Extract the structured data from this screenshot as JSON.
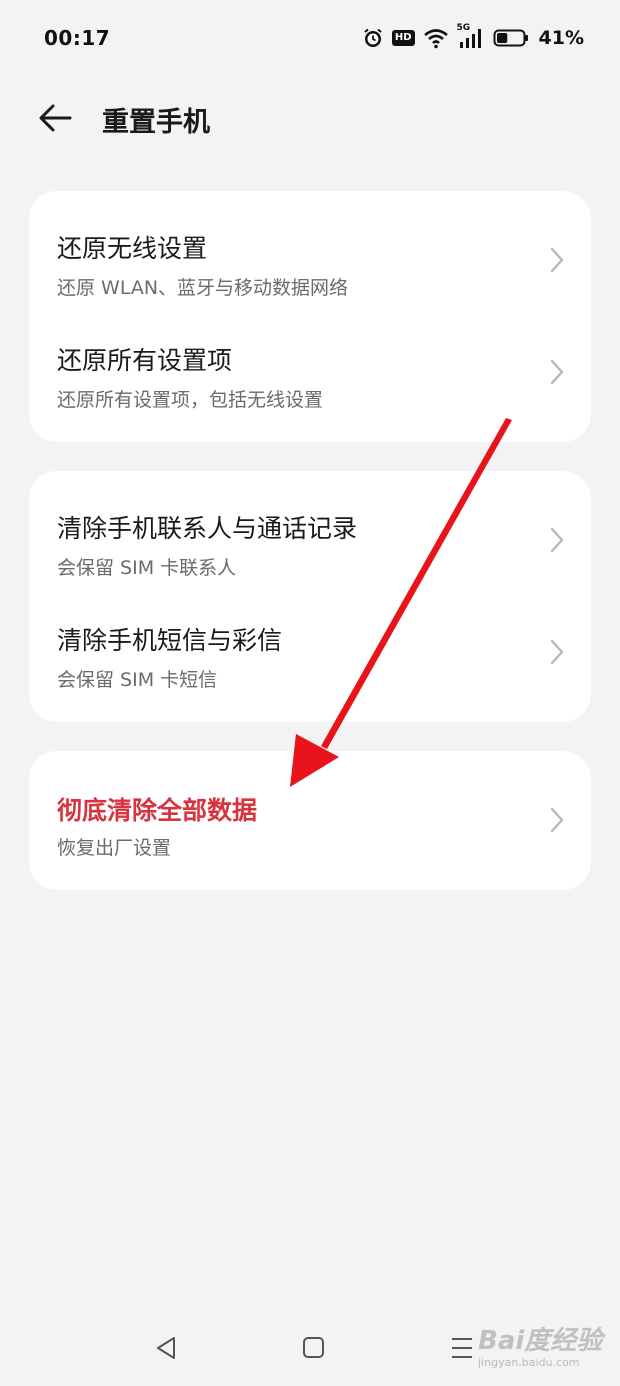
{
  "status": {
    "time": "00:17",
    "hd_label": "HD",
    "network_label": "5G",
    "battery_percent": "41%",
    "battery_level": 0.41
  },
  "header": {
    "title": "重置手机",
    "back_icon": "arrow-left-icon"
  },
  "groups": [
    {
      "items": [
        {
          "title": "还原无线设置",
          "subtitle": "还原 WLAN、蓝牙与移动数据网络"
        },
        {
          "title": "还原所有设置项",
          "subtitle": "还原所有设置项，包括无线设置"
        }
      ]
    },
    {
      "items": [
        {
          "title": "清除手机联系人与通话记录",
          "subtitle": "会保留 SIM 卡联系人"
        },
        {
          "title": "清除手机短信与彩信",
          "subtitle": "会保留 SIM 卡短信"
        }
      ]
    },
    {
      "items": [
        {
          "title": "彻底清除全部数据",
          "subtitle": "恢复出厂设置"
        }
      ]
    }
  ],
  "colors": {
    "background": "#f3f3f3",
    "card": "#ffffff",
    "danger": "#d8343f",
    "annotation_arrow": "#e8131b"
  },
  "nav": {
    "back_icon": "triangle-back-icon",
    "home_icon": "square-home-icon",
    "menu_icon": "menu-lines-icon"
  },
  "watermark": {
    "text": "Bai度经验",
    "url": "jingyan.baidu.com"
  }
}
